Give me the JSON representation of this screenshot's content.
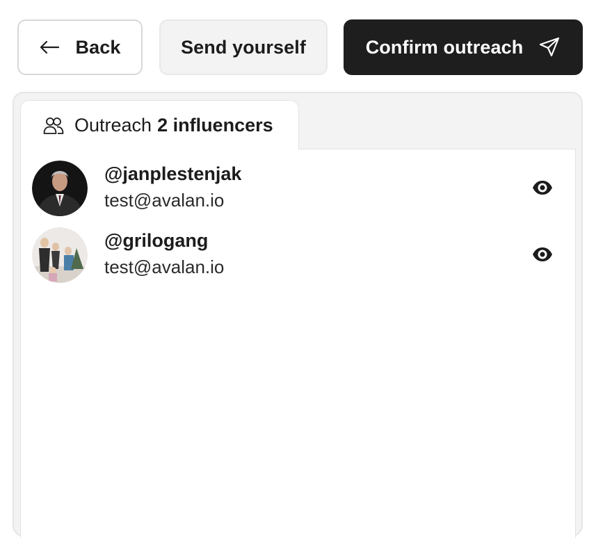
{
  "toolbar": {
    "back_label": "Back",
    "send_yourself_label": "Send yourself",
    "confirm_label": "Confirm outreach"
  },
  "tab": {
    "prefix": "Outreach",
    "count_label": "2 influencers"
  },
  "influencers": [
    {
      "handle": "@janplestenjak",
      "email": "test@avalan.io"
    },
    {
      "handle": "@grilogang",
      "email": "test@avalan.io"
    }
  ],
  "icons": {
    "back": "arrow-left-icon",
    "confirm": "paper-plane-icon",
    "tab": "users-icon",
    "view": "eye-icon"
  },
  "colors": {
    "primary_button_bg": "#1e1e1e",
    "secondary_button_bg": "#f2f3f2",
    "panel_bg": "#f2f3f2",
    "text": "#1c1c1c"
  }
}
